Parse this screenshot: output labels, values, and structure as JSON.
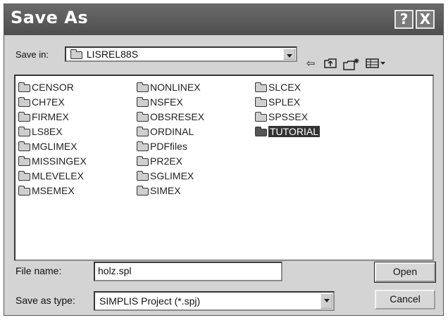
{
  "window": {
    "title": "Save As",
    "help_label": "?",
    "close_label": "X"
  },
  "toolbar": {
    "save_in_label": "Save in:",
    "save_in_value": "LISREL88S",
    "back_icon": "back-arrow-icon",
    "up_icon": "up-one-level-icon",
    "new_folder_icon": "new-folder-icon",
    "view_menu_icon": "view-menu-icon"
  },
  "files": [
    {
      "name": "CENSOR"
    },
    {
      "name": "CH7EX"
    },
    {
      "name": "FIRMEX"
    },
    {
      "name": "LS8EX"
    },
    {
      "name": "MGLIMEX"
    },
    {
      "name": "MISSINGEX"
    },
    {
      "name": "MLEVELEX"
    },
    {
      "name": "MSEMEX"
    },
    {
      "name": "NONLINEX"
    },
    {
      "name": "NSFEX"
    },
    {
      "name": "OBSRESEX"
    },
    {
      "name": "ORDINAL"
    },
    {
      "name": "PDFfiles"
    },
    {
      "name": "PR2EX"
    },
    {
      "name": "SGLIMEX"
    },
    {
      "name": "SIMEX"
    },
    {
      "name": "SLCEX"
    },
    {
      "name": "SPLEX"
    },
    {
      "name": "SPSSEX"
    },
    {
      "name": "TUTORIAL",
      "selected": true
    }
  ],
  "form": {
    "file_name_label": "File name:",
    "file_name_value": "holz.spl",
    "save_type_label": "Save as type:",
    "save_type_value": "SIMPLIS Project (*.spj)",
    "open_label": "Open",
    "cancel_label": "Cancel"
  }
}
